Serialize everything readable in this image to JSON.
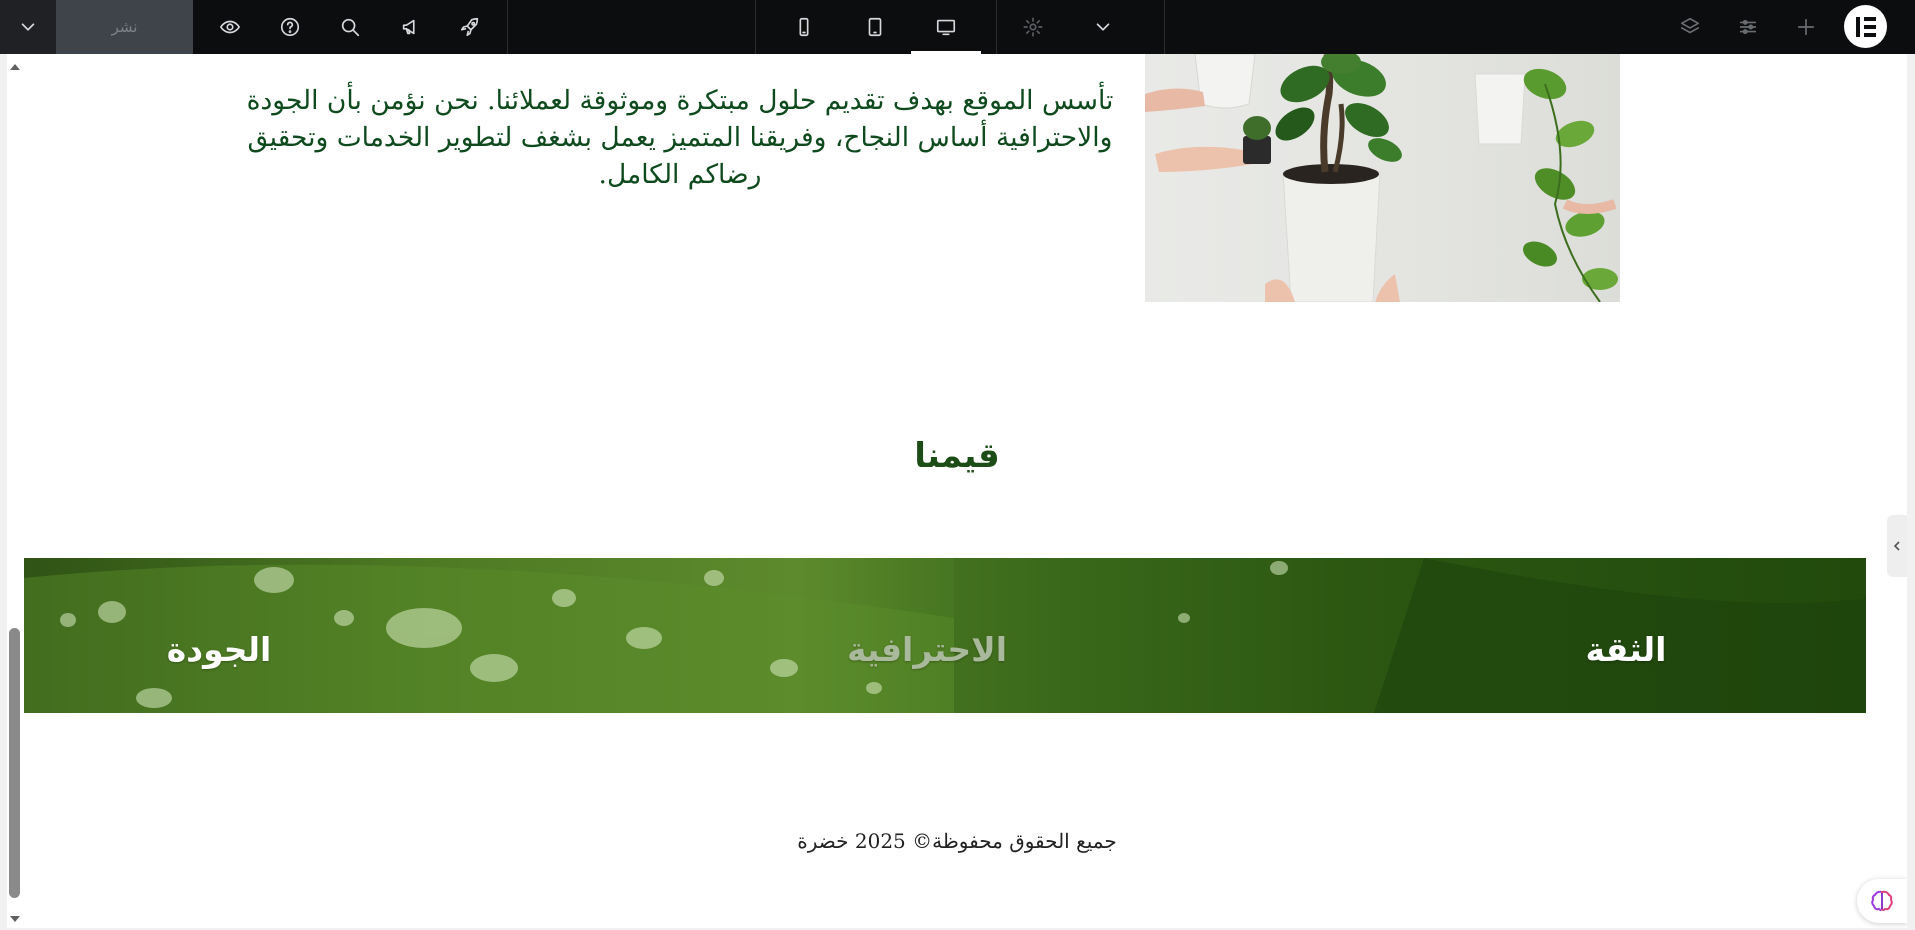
{
  "toolbar": {
    "publish_label": "نشر",
    "icons": [
      "chevron-down-icon",
      "eye-icon",
      "help-icon",
      "search-icon",
      "megaphone-icon",
      "rocket-icon",
      "mobile-icon",
      "tablet-icon",
      "desktop-icon",
      "gear-icon",
      "chevron-down-icon",
      "layers-icon",
      "sliders-icon",
      "plus-icon",
      "elementor-logo"
    ],
    "active_device": "desktop"
  },
  "page": {
    "about_text": "تأسس الموقع بهدف تقديم حلول مبتكرة وموثوقة لعملائنا. نحن نؤمن بأن الجودة والاحترافية أساس النجاح، وفريقنا المتميز يعمل بشغف لتطوير الخدمات وتحقيق رضاكم الكامل.",
    "values_heading": "قيمنا",
    "values": [
      "الثقة",
      "الاحترافية",
      "الجودة"
    ],
    "footer": "جميع الحقوق محفوظة© 2025 خضرة"
  },
  "colors": {
    "topbar": "#0c0d0e",
    "text_green": "#0e4a1d",
    "heading_green": "#1d4d16",
    "band_green": "#3b6a1b"
  }
}
